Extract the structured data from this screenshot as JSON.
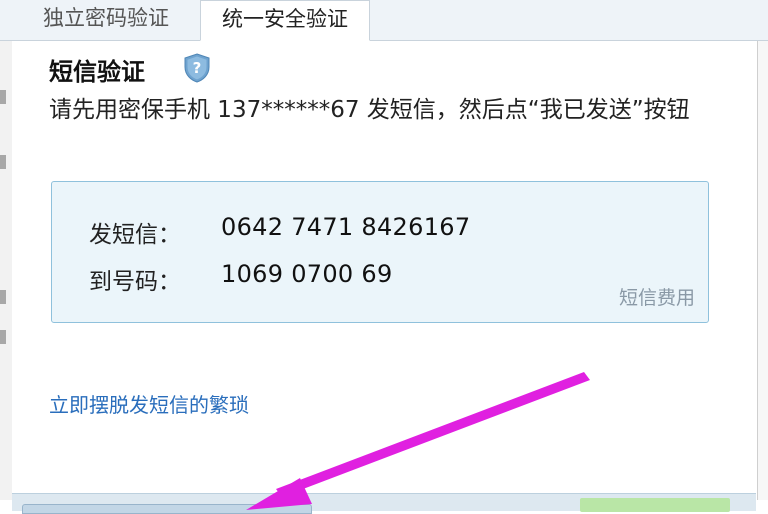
{
  "tabs": [
    {
      "label": "独立密码验证",
      "active": false
    },
    {
      "label": "统一安全验证",
      "active": true
    }
  ],
  "section": {
    "title": "短信验证",
    "help_icon": "shield-question-icon"
  },
  "instruction": "请先用密保手机 137******67 发短信，然后点“我已发送”按钮",
  "sms": {
    "content_label": "发短信：",
    "content_value": "0642 7471 8426167",
    "number_label": "到号码：",
    "number_value": "1069 0700 69",
    "fee_link": "短信费用"
  },
  "skip_link": "立即摆脱发短信的繁琐",
  "colors": {
    "box_bg": "#ebf5fa",
    "box_border": "#8fc1dc",
    "link": "#2a6ebc",
    "annotation_arrow": "#e020e0"
  }
}
